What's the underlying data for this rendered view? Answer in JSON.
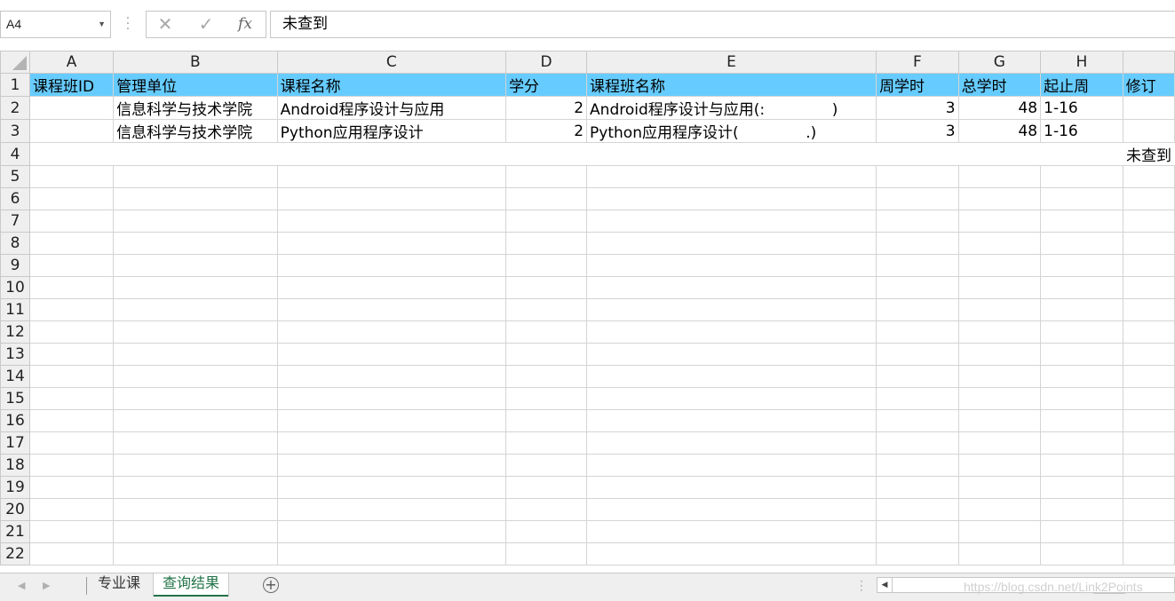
{
  "formula_bar": {
    "name_box": "A4",
    "cancel_icon": "✕",
    "enter_icon": "✓",
    "fx_label": "fx",
    "formula": "未查到"
  },
  "columns": [
    "A",
    "B",
    "C",
    "D",
    "E",
    "F",
    "G",
    "H",
    ""
  ],
  "row_numbers": [
    "1",
    "2",
    "3",
    "4",
    "5",
    "6",
    "7",
    "8",
    "9",
    "10",
    "11",
    "12",
    "13",
    "14",
    "15",
    "16",
    "17",
    "18",
    "19",
    "20",
    "21",
    "22"
  ],
  "header_row": [
    "课程班ID",
    "管理单位",
    "课程名称",
    "学分",
    "课程班名称",
    "周学时",
    "总学时",
    "起止周",
    "修订"
  ],
  "data_rows": [
    [
      "",
      "信息科学与技术学院",
      "Android程序设计与应用",
      "2",
      "Android程序设计与应用(:              )",
      "3",
      "48",
      "1-16",
      ""
    ],
    [
      "",
      "信息科学与技术学院",
      "Python应用程序设计",
      "2",
      "Python应用程序设计(              .)",
      "3",
      "48",
      "1-16",
      ""
    ]
  ],
  "row4_text": "未查到",
  "sheet_tabs": [
    "专业课",
    "查询结果"
  ],
  "active_sheet": "查询结果",
  "watermark": "https://blog.csdn.net/Link2Points",
  "colors": {
    "header_fill": "#66ccff",
    "active_tab": "#217346",
    "grid_line": "#d4d4d4"
  }
}
